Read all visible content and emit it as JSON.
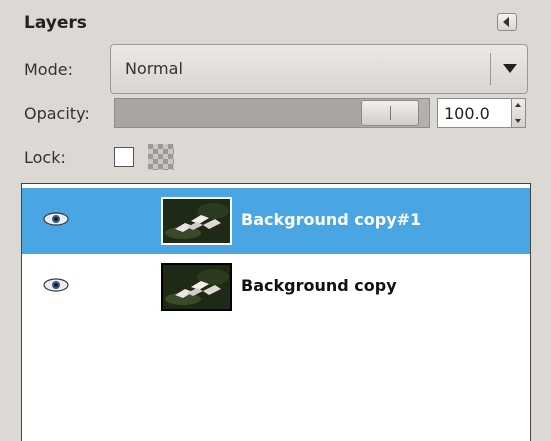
{
  "panel": {
    "title": "Layers",
    "mode_label": "Mode:",
    "mode_value": "Normal",
    "opacity_label": "Opacity:",
    "opacity_value": "100.0",
    "opacity_level": 1.0,
    "lock_label": "Lock:"
  },
  "layers": [
    {
      "name": "Background copy#1",
      "selected": true,
      "visible": true
    },
    {
      "name": "Background copy",
      "selected": false,
      "visible": true
    }
  ],
  "colors": {
    "selection": "#4aa6e3",
    "panel_bg": "#dcd9d4"
  },
  "icons": {
    "collapse": "triangle-left-icon",
    "visibility": "eye-icon",
    "lock_pixels": "checkbox-icon",
    "lock_alpha": "checkerboard-icon"
  }
}
